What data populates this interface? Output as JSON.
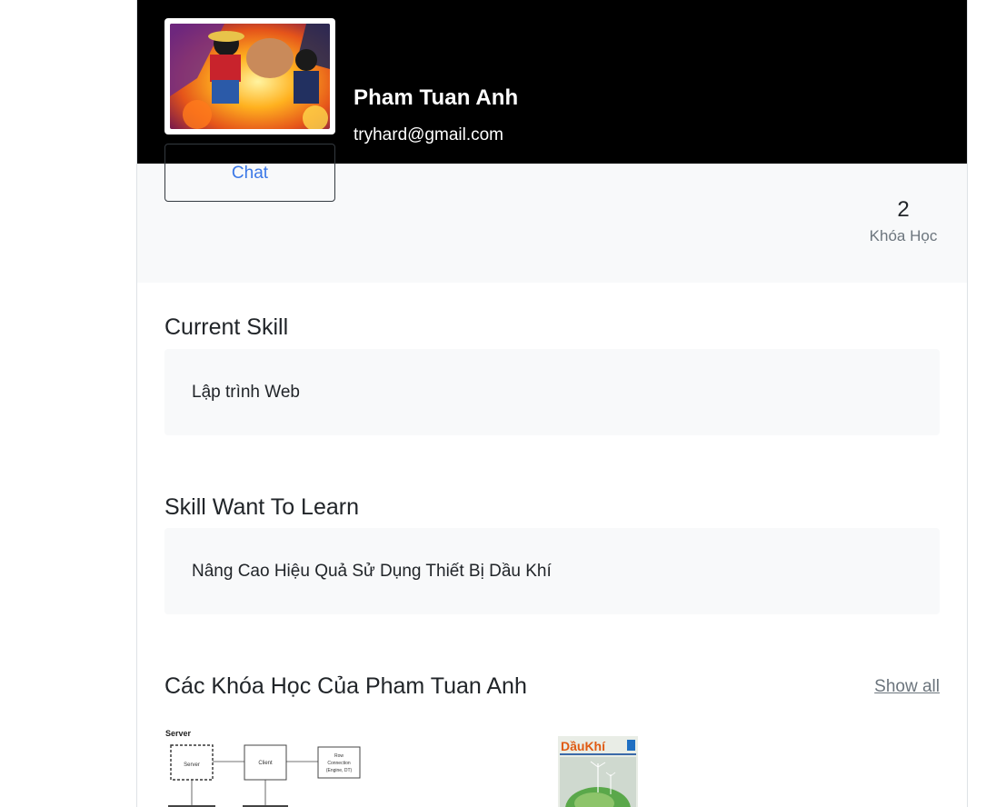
{
  "profile": {
    "name": "Pham Tuan Anh",
    "email": "tryhard@gmail.com",
    "chat_label": "Chat"
  },
  "stats": {
    "course_count": "2",
    "course_label": "Khóa Học"
  },
  "current_skill": {
    "title": "Current Skill",
    "value": "Lập trình Web"
  },
  "skill_want": {
    "title": "Skill Want To Learn",
    "value": "Nâng Cao Hiệu Quả Sử Dụng Thiết Bị Dầu Khí"
  },
  "courses": {
    "title": "Các Khóa Học Của Pham Tuan Anh",
    "show_all_label": "Show all",
    "items": [
      {
        "thumb_texts": {
          "heading": "Server",
          "box1": "Server",
          "box2": "Client",
          "box3": "Row",
          "box3b": "Connection",
          "box3c": "(Engine, DT)"
        }
      },
      {
        "thumb_texts": {
          "brand": "DầuKhí"
        }
      }
    ]
  },
  "colors": {
    "cover": "#000000",
    "link": "#3b78e7",
    "panel": "#f8f9fa",
    "muted": "#6c757d"
  },
  "icons": {
    "avatar": "anime-avatar-image"
  }
}
